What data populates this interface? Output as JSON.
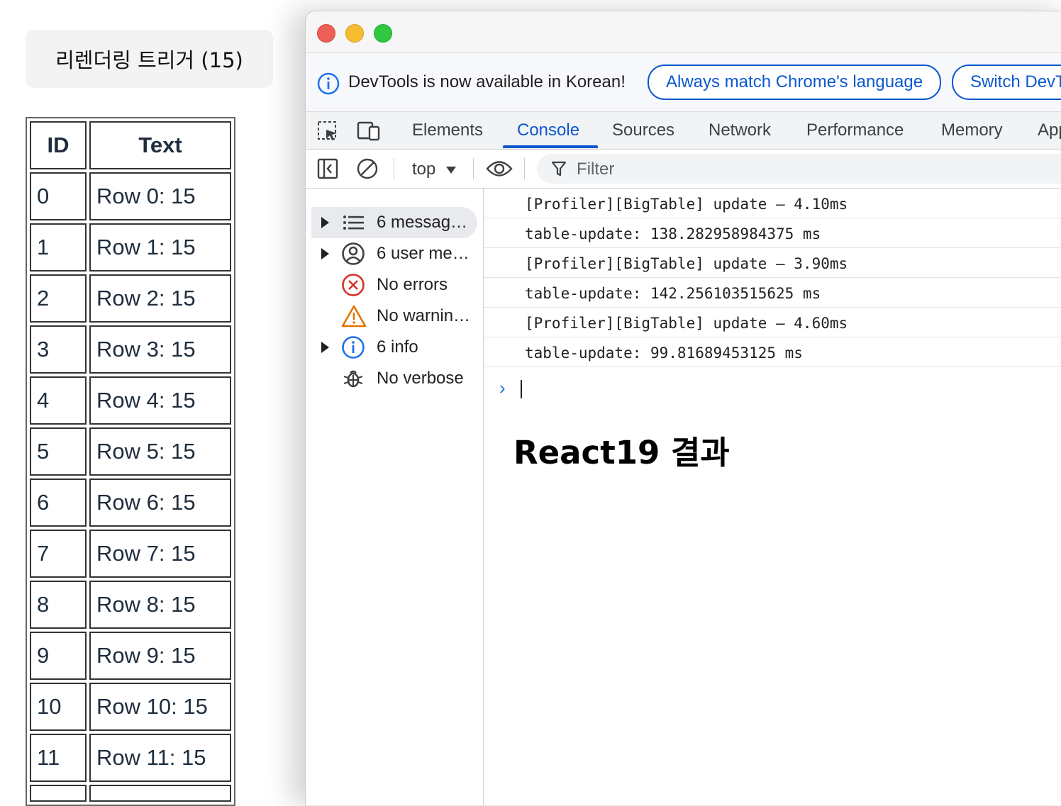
{
  "page": {
    "trigger_button": "리렌더링 트리거 (15)",
    "table": {
      "headers": {
        "id": "ID",
        "text": "Text"
      },
      "rows": [
        {
          "id": "0",
          "text": "Row 0: 15"
        },
        {
          "id": "1",
          "text": "Row 1: 15"
        },
        {
          "id": "2",
          "text": "Row 2: 15"
        },
        {
          "id": "3",
          "text": "Row 3: 15"
        },
        {
          "id": "4",
          "text": "Row 4: 15"
        },
        {
          "id": "5",
          "text": "Row 5: 15"
        },
        {
          "id": "6",
          "text": "Row 6: 15"
        },
        {
          "id": "7",
          "text": "Row 7: 15"
        },
        {
          "id": "8",
          "text": "Row 8: 15"
        },
        {
          "id": "9",
          "text": "Row 9: 15"
        },
        {
          "id": "10",
          "text": "Row 10: 15"
        },
        {
          "id": "11",
          "text": "Row 11: 15"
        }
      ]
    }
  },
  "devtools": {
    "infobar": {
      "message": "DevTools is now available in Korean!",
      "btn_match": "Always match Chrome's language",
      "btn_switch": "Switch DevT"
    },
    "tabs": [
      "Elements",
      "Console",
      "Sources",
      "Network",
      "Performance",
      "Memory",
      "App"
    ],
    "active_tab": "Console",
    "toolbar": {
      "context": "top",
      "filter_placeholder": "Filter"
    },
    "sidebar": [
      {
        "label": "6 messag…",
        "icon": "list-icon",
        "expandable": true,
        "selected": true
      },
      {
        "label": "6 user me…",
        "icon": "user-icon",
        "expandable": true,
        "selected": false
      },
      {
        "label": "No errors",
        "icon": "error-icon",
        "expandable": false,
        "selected": false
      },
      {
        "label": "No warnin…",
        "icon": "warning-icon",
        "expandable": false,
        "selected": false
      },
      {
        "label": "6 info",
        "icon": "info-icon",
        "expandable": true,
        "selected": false
      },
      {
        "label": "No verbose",
        "icon": "bug-icon",
        "expandable": false,
        "selected": false
      }
    ],
    "logs": [
      "[Profiler][BigTable] update — 4.10ms",
      "table-update: 138.282958984375 ms",
      "[Profiler][BigTable] update — 3.90ms",
      "table-update: 142.256103515625 ms",
      "[Profiler][BigTable] update — 4.60ms",
      "table-update: 99.81689453125 ms"
    ],
    "prompt": "›",
    "overlay_title": "React19 결과"
  },
  "colors": {
    "accent": "#0b57d0",
    "error": "#d93025",
    "warning": "#e37400",
    "info": "#1a73e8"
  }
}
